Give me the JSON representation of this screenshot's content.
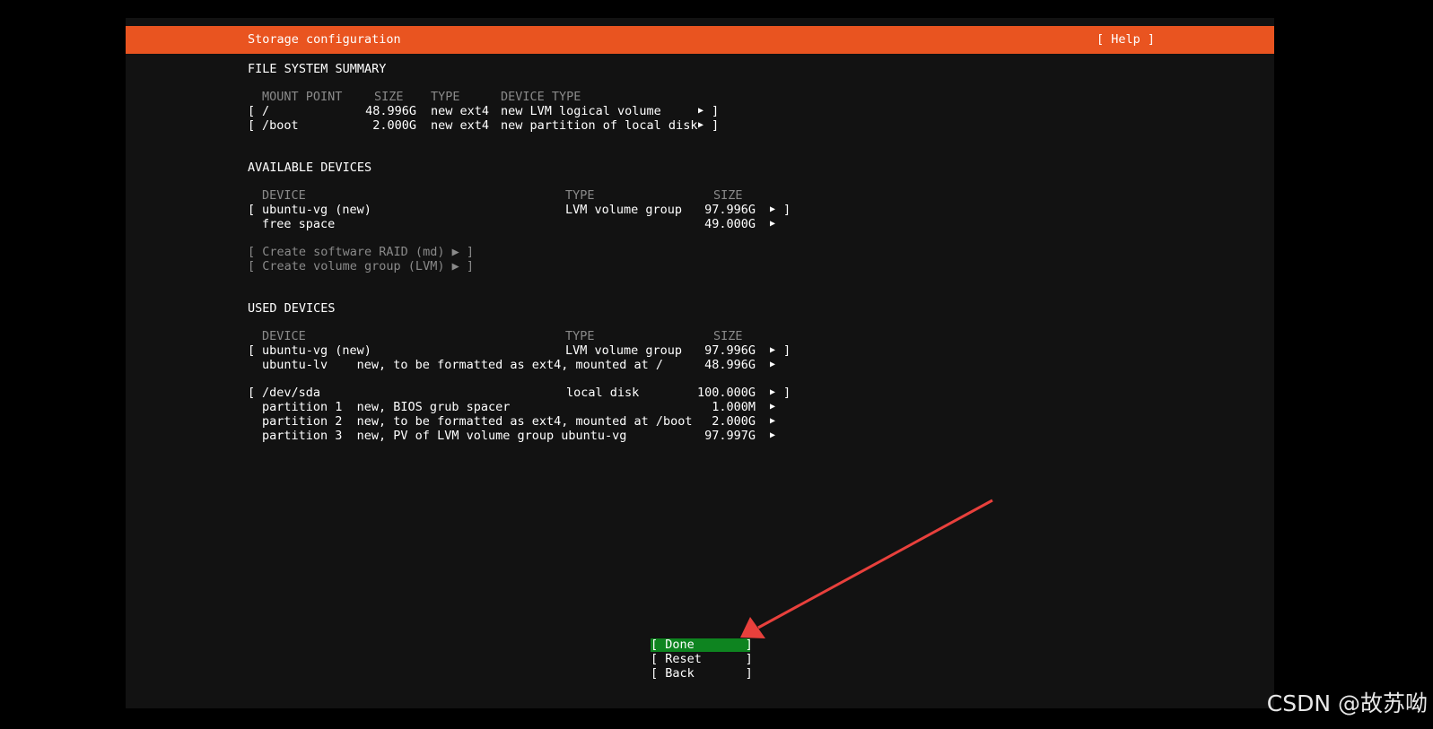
{
  "header": {
    "title": "Storage configuration",
    "help": "[ Help ]"
  },
  "fs_summary": {
    "heading": "FILE SYSTEM SUMMARY",
    "columns": [
      "MOUNT POINT",
      "SIZE",
      "TYPE",
      "DEVICE TYPE"
    ],
    "rows": [
      {
        "open": "[",
        "mount": "/",
        "size": "48.996G",
        "type": "new ext4",
        "device_type": "new LVM logical volume",
        "arrow": "▶",
        "close": "]"
      },
      {
        "open": "[",
        "mount": "/boot",
        "size": "2.000G",
        "type": "new ext4",
        "device_type": "new partition of local disk",
        "arrow": "▶",
        "close": "]"
      }
    ]
  },
  "available": {
    "heading": "AVAILABLE DEVICES",
    "columns": [
      "DEVICE",
      "TYPE",
      "SIZE"
    ],
    "rows": [
      {
        "open": "[",
        "device": "ubuntu-vg (new)",
        "type": "LVM volume group",
        "size": "97.996G",
        "arrow": "▶",
        "close": "]"
      },
      {
        "open": "",
        "device": "free space",
        "type": "",
        "size": "49.000G",
        "arrow": "▶",
        "close": ""
      }
    ],
    "actions": [
      "[ Create software RAID (md) ▶ ]",
      "[ Create volume group (LVM) ▶ ]"
    ]
  },
  "used": {
    "heading": "USED DEVICES",
    "columns": [
      "DEVICE",
      "TYPE",
      "SIZE"
    ],
    "rows": [
      {
        "open": "[",
        "device": "ubuntu-vg (new)",
        "type": "LVM volume group",
        "size": "97.996G",
        "arrow": "▶",
        "close": "]"
      },
      {
        "open": "",
        "device": "ubuntu-lv    new, to be formatted as ext4, mounted at /",
        "type": "",
        "size": "48.996G",
        "arrow": "▶",
        "close": ""
      },
      {
        "open": "[",
        "device": "/dev/sda",
        "type": "local disk",
        "size": "100.000G",
        "arrow": "▶",
        "close": "]"
      },
      {
        "open": "",
        "device": "partition 1  new, BIOS grub spacer",
        "type": "",
        "size": "1.000M",
        "arrow": "▶",
        "close": ""
      },
      {
        "open": "",
        "device": "partition 2  new, to be formatted as ext4, mounted at /boot",
        "type": "",
        "size": "2.000G",
        "arrow": "▶",
        "close": ""
      },
      {
        "open": "",
        "device": "partition 3  new, PV of LVM volume group ubuntu-vg",
        "type": "",
        "size": "97.997G",
        "arrow": "▶",
        "close": ""
      }
    ]
  },
  "buttons": {
    "done": "[ Done       ]",
    "reset": "[ Reset      ]",
    "back": "[ Back       ]"
  },
  "watermark": "CSDN @故苏呦",
  "colors": {
    "header": "#E95420",
    "focus": "#0E8420",
    "annotation_arrow": "#E8403C"
  }
}
